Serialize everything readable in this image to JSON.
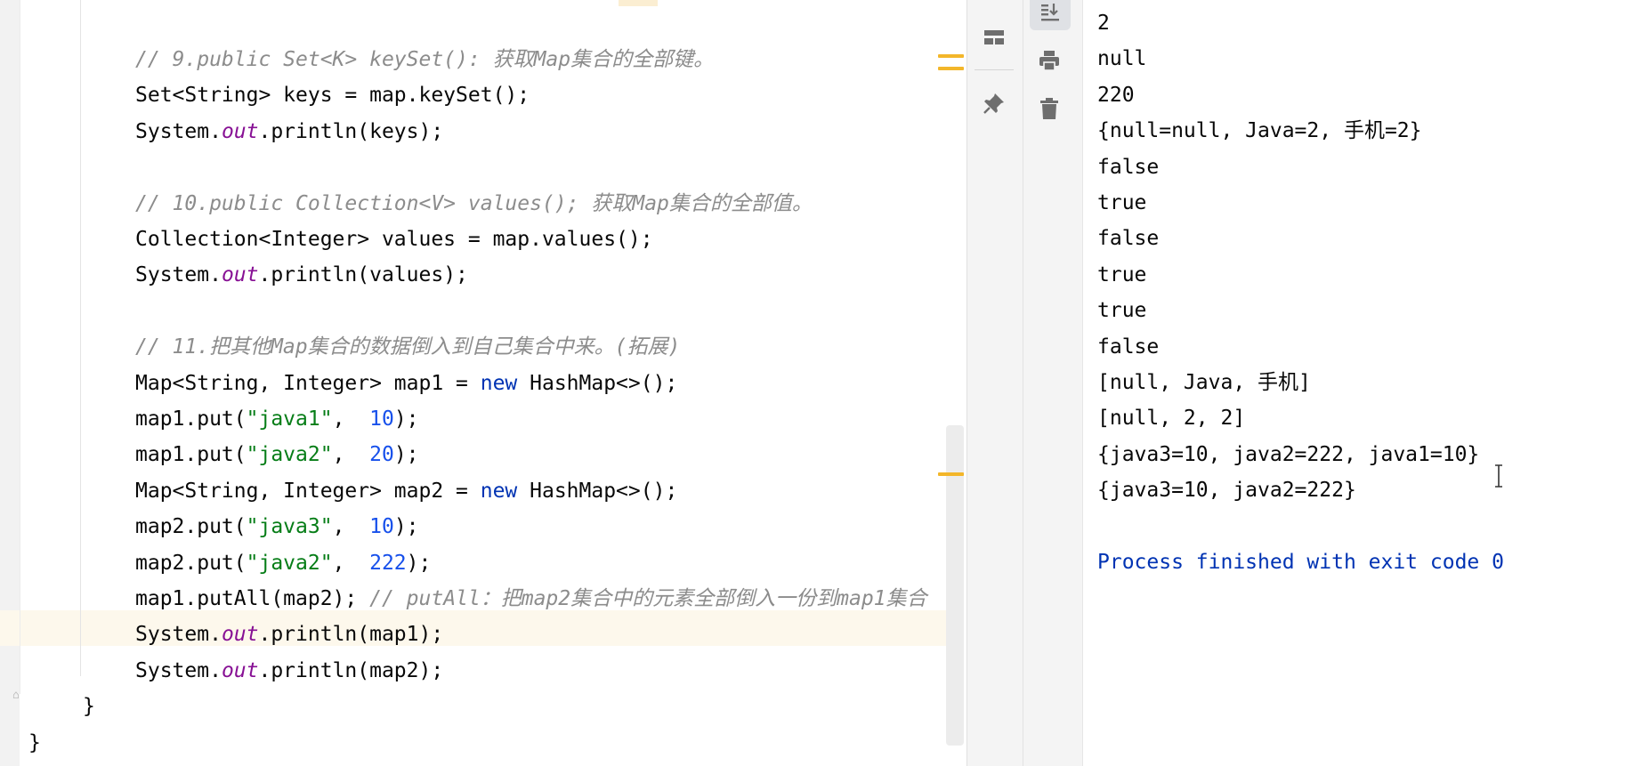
{
  "editor": {
    "lines": [
      {
        "name": "comment-keyset",
        "indent": 3,
        "tokens": [
          {
            "t": "// 9.public Set<K> keySet(): 获取Map集合的全部键。",
            "c": "cm"
          }
        ]
      },
      {
        "name": "keys-declaration",
        "indent": 3,
        "tokens": [
          {
            "t": "Set<String> keys = map.keySet();",
            "c": ""
          }
        ]
      },
      {
        "name": "print-keys",
        "indent": 3,
        "tokens": [
          {
            "t": "System.",
            "c": ""
          },
          {
            "t": "out",
            "c": "fld"
          },
          {
            "t": ".println(keys);",
            "c": ""
          }
        ]
      },
      {
        "name": "blank-1",
        "indent": 3,
        "tokens": []
      },
      {
        "name": "comment-values",
        "indent": 3,
        "tokens": [
          {
            "t": "// 10.public Collection<V> values(); 获取Map集合的全部值。",
            "c": "cm"
          }
        ]
      },
      {
        "name": "values-declaration",
        "indent": 3,
        "tokens": [
          {
            "t": "Collection<Integer> values = map.values();",
            "c": ""
          }
        ]
      },
      {
        "name": "print-values",
        "indent": 3,
        "tokens": [
          {
            "t": "System.",
            "c": ""
          },
          {
            "t": "out",
            "c": "fld"
          },
          {
            "t": ".println(values);",
            "c": ""
          }
        ]
      },
      {
        "name": "blank-2",
        "indent": 3,
        "tokens": []
      },
      {
        "name": "comment-putall",
        "indent": 3,
        "tokens": [
          {
            "t": "// 11.把其他Map集合的数据倒入到自己集合中来。(拓展)",
            "c": "cm"
          }
        ]
      },
      {
        "name": "map1-declaration",
        "indent": 3,
        "tokens": [
          {
            "t": "Map<String, Integer> map1 = ",
            "c": ""
          },
          {
            "t": "new",
            "c": "kw"
          },
          {
            "t": " HashMap<>();",
            "c": ""
          }
        ]
      },
      {
        "name": "map1-put-java1",
        "indent": 3,
        "tokens": [
          {
            "t": "map1.put(",
            "c": ""
          },
          {
            "t": "\"java1\"",
            "c": "str"
          },
          {
            "t": ",  ",
            "c": ""
          },
          {
            "t": "10",
            "c": "num"
          },
          {
            "t": ");",
            "c": ""
          }
        ]
      },
      {
        "name": "map1-put-java2",
        "indent": 3,
        "tokens": [
          {
            "t": "map1.put(",
            "c": ""
          },
          {
            "t": "\"java2\"",
            "c": "str"
          },
          {
            "t": ",  ",
            "c": ""
          },
          {
            "t": "20",
            "c": "num"
          },
          {
            "t": ");",
            "c": ""
          }
        ]
      },
      {
        "name": "map2-declaration",
        "indent": 3,
        "tokens": [
          {
            "t": "Map<String, Integer> map2 = ",
            "c": ""
          },
          {
            "t": "new",
            "c": "kw"
          },
          {
            "t": " HashMap<>();",
            "c": ""
          }
        ]
      },
      {
        "name": "map2-put-java3",
        "indent": 3,
        "tokens": [
          {
            "t": "map2.put(",
            "c": ""
          },
          {
            "t": "\"java3\"",
            "c": "str"
          },
          {
            "t": ",  ",
            "c": ""
          },
          {
            "t": "10",
            "c": "num"
          },
          {
            "t": ");",
            "c": ""
          }
        ]
      },
      {
        "name": "map2-put-java2",
        "indent": 3,
        "tokens": [
          {
            "t": "map2.put(",
            "c": ""
          },
          {
            "t": "\"java2\"",
            "c": "str"
          },
          {
            "t": ",  ",
            "c": ""
          },
          {
            "t": "222",
            "c": "num"
          },
          {
            "t": ");",
            "c": ""
          }
        ]
      },
      {
        "name": "putall-call",
        "indent": 3,
        "tokens": [
          {
            "t": "map1.putAll(map2); ",
            "c": ""
          },
          {
            "t": "// putAll：把map2集合中的元素全部倒入一份到map1集合",
            "c": "cm"
          }
        ]
      },
      {
        "name": "print-map1",
        "indent": 3,
        "tokens": [
          {
            "t": "System.",
            "c": ""
          },
          {
            "t": "out",
            "c": "fld"
          },
          {
            "t": ".println(map1);",
            "c": ""
          }
        ]
      },
      {
        "name": "print-map2",
        "indent": 3,
        "tokens": [
          {
            "t": "System.",
            "c": ""
          },
          {
            "t": "out",
            "c": "fld"
          },
          {
            "t": ".println(map2);",
            "c": ""
          }
        ]
      },
      {
        "name": "method-close-brace",
        "indent": 2,
        "tokens": [
          {
            "t": "}",
            "c": ""
          }
        ]
      },
      {
        "name": "class-close-brace",
        "indent": 1,
        "tokens": [
          {
            "t": "}",
            "c": ""
          }
        ]
      }
    ]
  },
  "toolbar": {
    "icons": [
      "scroll-to-end-icon",
      "layout-icon",
      "print-icon",
      "pin-icon",
      "trash-icon"
    ]
  },
  "console": {
    "lines": [
      "2",
      "null",
      "220",
      "{null=null, Java=2, 手机=2}",
      "false",
      "true",
      "false",
      "true",
      "true",
      "false",
      "[null, Java, 手机]",
      "[null, 2, 2]",
      "{java3=10, java2=222, java1=10}",
      "{java3=10, java2=222}",
      ""
    ],
    "exit_message": "Process finished with exit code 0"
  },
  "colors": {
    "keyword": "#0033b3",
    "string": "#067d17",
    "number": "#1750eb",
    "field": "#871094",
    "comment": "#8c8c8c",
    "marker": "#f3b62a",
    "caret_line": "#fdf8ec"
  }
}
